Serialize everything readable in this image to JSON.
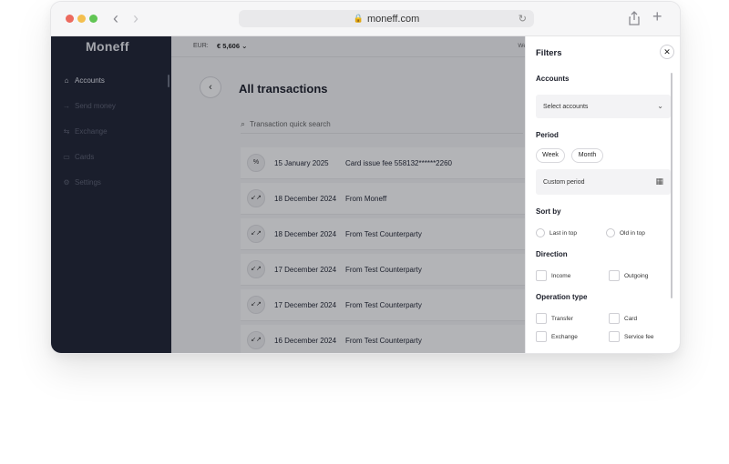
{
  "browser": {
    "url": "moneff.com",
    "back_glyph": "‹",
    "forward_glyph": "›",
    "lock_glyph": "🔒",
    "reload_glyph": "↻",
    "new_tab_glyph": "+"
  },
  "sidebar": {
    "logo": "Moneff",
    "items": [
      {
        "label": "Accounts",
        "icon": "⌂"
      },
      {
        "label": "Send money",
        "icon": "→"
      },
      {
        "label": "Exchange",
        "icon": "⇆"
      },
      {
        "label": "Cards",
        "icon": "▭"
      },
      {
        "label": "Settings",
        "icon": "⚙"
      }
    ]
  },
  "topbar": {
    "currency_label": "EUR:",
    "balance": "€ 5,606 ⌄",
    "right_text": "We"
  },
  "main": {
    "back_glyph": "‹",
    "title": "All transactions",
    "search_icon": "⌕",
    "search_placeholder": "Transaction quick search",
    "transactions": [
      {
        "icon": "%",
        "date": "15 January 2025",
        "desc": "Card issue fee 558132******2260"
      },
      {
        "icon": "↙↗",
        "date": "18 December 2024",
        "desc": "From Moneff"
      },
      {
        "icon": "↙↗",
        "date": "18 December 2024",
        "desc": "From Test Counterparty"
      },
      {
        "icon": "↙↗",
        "date": "17 December 2024",
        "desc": "From Test Counterparty"
      },
      {
        "icon": "↙↗",
        "date": "17 December 2024",
        "desc": "From Test Counterparty"
      },
      {
        "icon": "↙↗",
        "date": "16 December 2024",
        "desc": "From Test Counterparty"
      }
    ]
  },
  "filters": {
    "title": "Filters",
    "close_glyph": "✕",
    "accounts_label": "Accounts",
    "accounts_placeholder": "Select accounts",
    "chevron_glyph": "⌄",
    "period_label": "Period",
    "period_chips": [
      "Week",
      "Month"
    ],
    "custom_period": "Custom period",
    "calendar_glyph": "▦",
    "sort_label": "Sort by",
    "sort_options": [
      "Last in top",
      "Old in top"
    ],
    "direction_label": "Direction",
    "direction_options": [
      "Income",
      "Outgoing"
    ],
    "operation_label": "Operation type",
    "operation_options": [
      "Transfer",
      "Card",
      "Exchange",
      "Service fee"
    ]
  }
}
